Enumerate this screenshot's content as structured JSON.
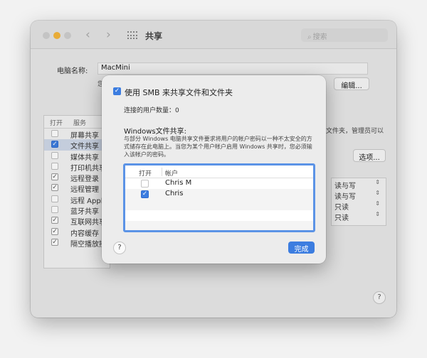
{
  "window": {
    "title": "共享",
    "search_placeholder": "搜索",
    "nav_back": "‹",
    "nav_forward": "›"
  },
  "computer": {
    "label": "电脑名称:",
    "name": "MacMini",
    "sub_text": "您",
    "edit_button": "编辑..."
  },
  "services": {
    "header_on": "打开",
    "header_service": "服务",
    "items": [
      {
        "name": "屏幕共享",
        "checked": false,
        "selected": false
      },
      {
        "name": "文件共享",
        "checked": true,
        "selected": true
      },
      {
        "name": "媒体共享",
        "checked": false,
        "selected": false
      },
      {
        "name": "打印机共享",
        "checked": false,
        "selected": false
      },
      {
        "name": "远程登录",
        "checked": true,
        "selected": false
      },
      {
        "name": "远程管理",
        "checked": true,
        "selected": false
      },
      {
        "name": "远程 Apple",
        "checked": false,
        "selected": false
      },
      {
        "name": "蓝牙共享",
        "checked": false,
        "selected": false
      },
      {
        "name": "互联网共享",
        "checked": true,
        "selected": false
      },
      {
        "name": "内容缓存",
        "checked": true,
        "selected": false
      },
      {
        "name": "隔空播放接",
        "checked": true,
        "selected": false
      }
    ]
  },
  "right_panel": {
    "description": "文件夹，管理员可以",
    "options_button": "选项...",
    "permissions": [
      "读与写",
      "读与写",
      "只读",
      "只读"
    ],
    "help": "?"
  },
  "sheet": {
    "smb_label": "使用 SMB 来共享文件和文件夹",
    "connected_users": "连接的用户数量：0",
    "windows_heading": "Windows文件共享:",
    "windows_desc": "与部分 Windows 电脑共享文件要求将用户的帐户密码以一种不太安全的方式储存在此电脑上。当您为某个用户帐户启用 Windows 共享时，您必须输入该帐户的密码。",
    "table_header_on": "打开",
    "table_header_account": "帐户",
    "accounts": [
      {
        "name": "Chris M",
        "checked": false
      },
      {
        "name": "Chris",
        "checked": true
      }
    ],
    "help": "?",
    "done_button": "完成"
  }
}
